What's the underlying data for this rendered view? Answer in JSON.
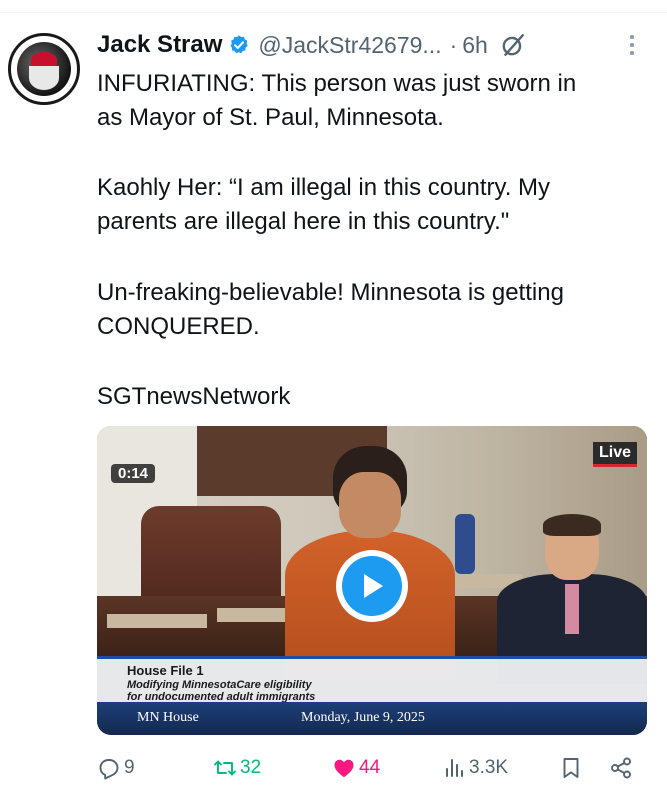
{
  "tweet": {
    "author_name": "Jack Straw",
    "author_handle": "@JackStr42679...",
    "separator": "·",
    "time": "6h",
    "verified": true,
    "text_lines": [
      [
        "INFURIATING: This person was just sworn in",
        "as Mayor of St. Paul, Minnesota."
      ],
      [
        "Kaohly Her: “I am illegal in this country. My",
        "parents are illegal here in this country.\""
      ],
      [
        "Un-freaking-believable! Minnesota is getting",
        "CONQUERED."
      ],
      [
        "SGTnewsNetwork"
      ]
    ]
  },
  "video": {
    "live_label": "Live",
    "timestamp": "0:14",
    "lower_third": {
      "title": "House File 1",
      "line1": "Modifying MinnesotaCare eligibility",
      "line2": "for undocumented adult immigrants",
      "source": "MN House",
      "date": "Monday, June 9, 2025"
    }
  },
  "actions": {
    "replies": "9",
    "reposts": "32",
    "likes": "44",
    "views": "3.3K"
  },
  "icons": [
    "verified-badge-icon",
    "grok-icon",
    "more-icon",
    "play-icon",
    "reply-icon",
    "repost-icon",
    "like-icon",
    "views-icon",
    "bookmark-icon",
    "share-icon"
  ],
  "colors": {
    "accent": "#1d9bf0",
    "repost": "#00ba7c",
    "like": "#f91880",
    "muted": "#536471",
    "text": "#0f1419"
  }
}
